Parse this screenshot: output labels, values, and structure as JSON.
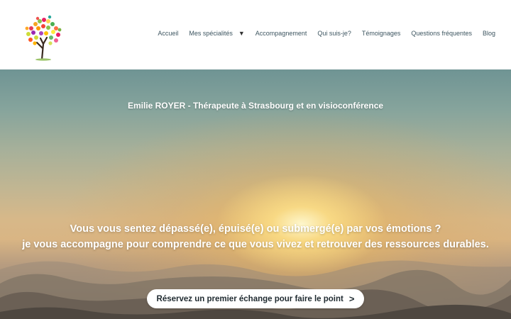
{
  "nav": {
    "items": [
      {
        "label": "Accueil"
      },
      {
        "label": "Mes spécialités",
        "icon": "chevron-down-icon"
      },
      {
        "label": "Accompagnement"
      },
      {
        "label": "Qui suis-je?"
      },
      {
        "label": "Témoignages"
      },
      {
        "label": "Questions fréquentes"
      },
      {
        "label": "Blog"
      }
    ]
  },
  "hero": {
    "subtitle": "Emilie ROYER - Thérapeute à Strasbourg et en visioconférence",
    "headline_line1": "Vous vous sentez dépassé(e), épuisé(e) ou submergé(e) par vos émotions ?",
    "headline_line2": "je vous accompagne pour comprendre ce que vous vivez et retrouver des ressources durables.",
    "cta_label": "Réservez un premier échange pour faire le point",
    "cta_icon": "arrow-right-icon"
  },
  "colors": {
    "nav_text": "#3d5560",
    "cta_text": "#1f2a30",
    "hero_text": "#ffffff"
  }
}
